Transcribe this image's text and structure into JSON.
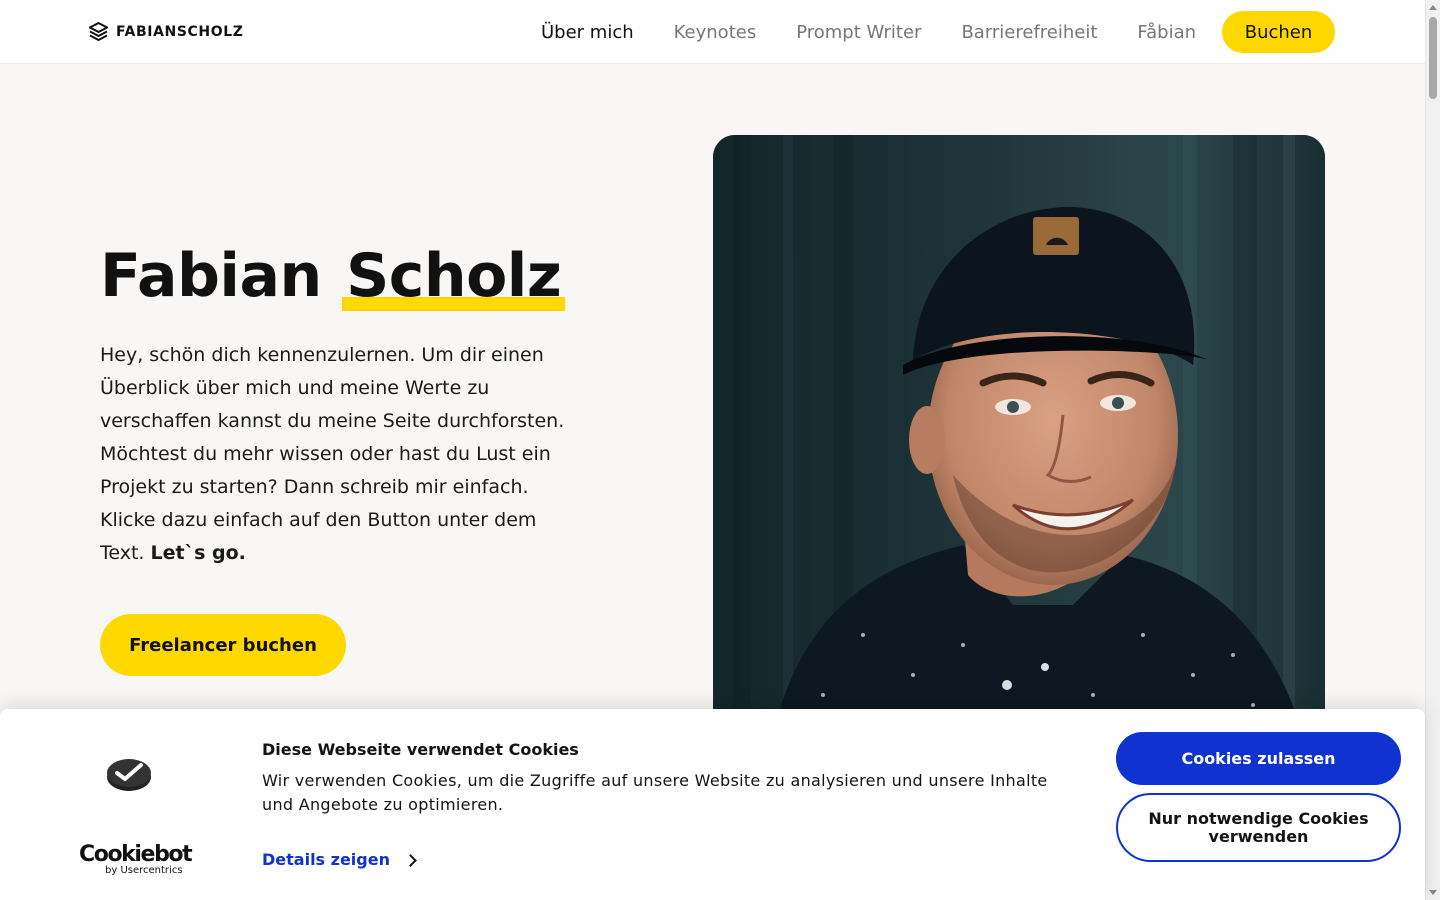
{
  "header": {
    "logo_text": "FABIANSCHOLZ",
    "nav": [
      {
        "label": "Über mich",
        "active": true
      },
      {
        "label": "Keynotes",
        "active": false
      },
      {
        "label": "Prompt Writer",
        "active": false
      },
      {
        "label": "Barrierefreiheit",
        "active": false
      },
      {
        "label": "Fåbian",
        "active": false
      }
    ],
    "book_label": "Buchen"
  },
  "hero": {
    "title_first": "Fabian",
    "title_highlight": "Scholz",
    "text": "Hey, schön dich kennenzulernen. Um dir einen Überblick über mich und meine Werte zu verschaffen kannst du meine Seite durchforsten. Möchtest du mehr wissen oder hast du Lust ein Projekt zu starten? Dann schreib mir einfach. Klicke dazu einfach auf den Button unter dem Text.",
    "text_bold": "Let`s go.",
    "button_label": "Freelancer buchen"
  },
  "cookie": {
    "brand_name": "Cookiebot",
    "brand_by": "by Usercentrics",
    "title": "Diese Webseite verwendet Cookies",
    "body": "Wir verwenden Cookies, um die Zugriffe auf unsere Website zu analysieren und unsere Inhalte und Angebote zu optimieren.",
    "details_label": "Details zeigen",
    "allow_label": "Cookies zulassen",
    "necessary_label": "Nur notwendige Cookies verwenden"
  },
  "colors": {
    "accent_yellow": "#ffd800",
    "cookie_blue": "#1032cf",
    "page_bg": "#f8f7f5"
  }
}
